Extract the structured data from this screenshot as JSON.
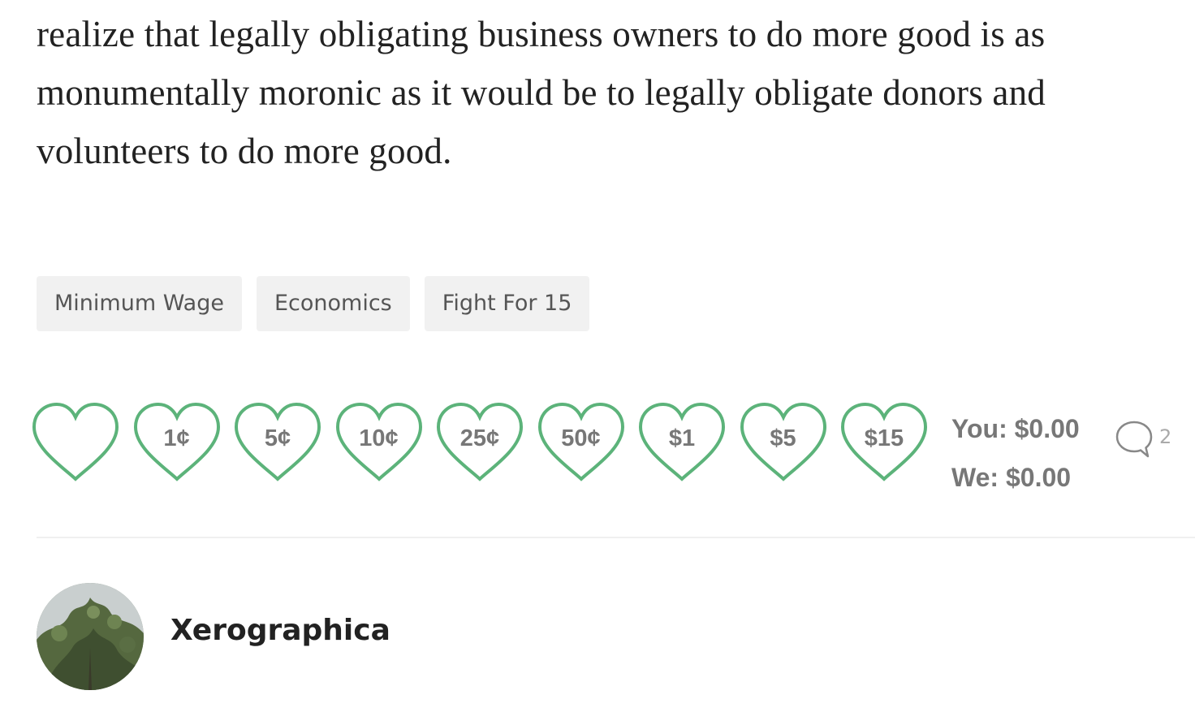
{
  "article": {
    "paragraph": "realize that legally obligating business owners to do more good is as monumentally moronic as it would be to legally obligate donors and volunteers to do more good."
  },
  "tags": [
    "Minimum Wage",
    "Economics",
    "Fight For 15"
  ],
  "tip_hearts": [
    "",
    "1¢",
    "5¢",
    "10¢",
    "25¢",
    "50¢",
    "$1",
    "$5",
    "$15"
  ],
  "totals": {
    "you": "You: $0.00",
    "we": "We: $0.00"
  },
  "comments": {
    "icon": "speech-bubble-icon",
    "count": "2"
  },
  "author": {
    "name": "Xerographica"
  },
  "colors": {
    "heart_stroke": "#5cb37a",
    "tag_bg": "#f1f1f1",
    "text": "#222222"
  }
}
